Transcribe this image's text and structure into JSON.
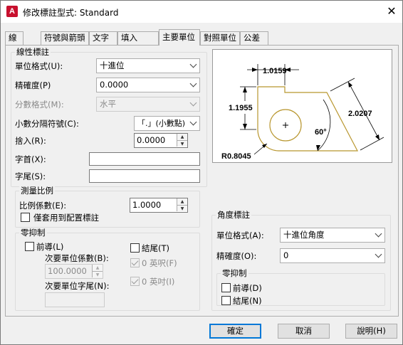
{
  "window": {
    "title": "修改標註型式: Standard",
    "app_icon": "A",
    "close_glyph": "✕"
  },
  "tabs": [
    {
      "label": "線"
    },
    {
      "label": "符號與箭頭"
    },
    {
      "label": "文字"
    },
    {
      "label": "填入"
    },
    {
      "label": "主要單位"
    },
    {
      "label": "對照單位"
    },
    {
      "label": "公差"
    }
  ],
  "linear": {
    "group_label": "線性標註",
    "unit_format_label": "單位格式(U):",
    "unit_format_value": "十進位",
    "precision_label": "精確度(P)",
    "precision_value": "0.0000",
    "fraction_format_label": "分數格式(M):",
    "fraction_format_value": "水平",
    "decimal_sep_label": "小數分隔符號(C):",
    "decimal_sep_value": "「.」(小數點)",
    "roundoff_label": "捨入(R):",
    "roundoff_value": "0.0000",
    "prefix_label": "字首(X):",
    "suffix_label": "字尾(S):"
  },
  "scale": {
    "group_label": "測量比例",
    "factor_label": "比例係數(E):",
    "factor_value": "1.0000",
    "layout_only_label": "僅套用到配置標註"
  },
  "zero_linear": {
    "group_label": "零抑制",
    "leading_label": "前導(L)",
    "trailing_label": "結尾(T)",
    "sub_factor_label": "次要單位係數(B):",
    "sub_factor_value": "100.0000",
    "sub_suffix_label": "次要單位字尾(N):",
    "feet_label": "0 英呎(F)",
    "inches_label": "0 英吋(I)"
  },
  "preview": {
    "dim_top": "1.0159",
    "dim_left": "1.1955",
    "dim_right": "2.0207",
    "angle": "60°",
    "radius": "R0.8045"
  },
  "angular": {
    "group_label": "角度標註",
    "unit_format_label": "單位格式(A):",
    "unit_format_value": "十進位角度",
    "precision_label": "精確度(O):",
    "precision_value": "0",
    "zero_group_label": "零抑制",
    "leading_label": "前導(D)",
    "trailing_label": "結尾(N)"
  },
  "buttons": {
    "ok": "確定",
    "cancel": "取消",
    "help": "說明(H)"
  },
  "colors": {
    "accent": "#0078d7",
    "preview_outline": "#b8962e"
  }
}
